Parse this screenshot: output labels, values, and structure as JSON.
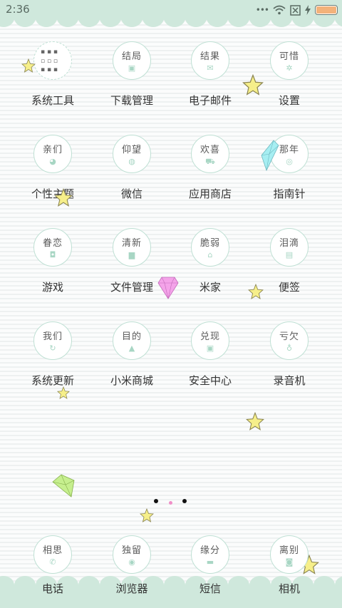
{
  "status": {
    "time": "2:36"
  },
  "apps": [
    {
      "cap": "",
      "glyph": "",
      "label": "系统工具"
    },
    {
      "cap": "结局",
      "glyph": "▣",
      "label": "下载管理"
    },
    {
      "cap": "结果",
      "glyph": "✉",
      "label": "电子邮件"
    },
    {
      "cap": "可惜",
      "glyph": "✲",
      "label": "设置"
    },
    {
      "cap": "亲们",
      "glyph": "◕",
      "label": "个性主题"
    },
    {
      "cap": "仰望",
      "glyph": "◍",
      "label": "微信"
    },
    {
      "cap": "欢喜",
      "glyph": "⛟",
      "label": "应用商店"
    },
    {
      "cap": "那年",
      "glyph": "◎",
      "label": "指南针"
    },
    {
      "cap": "眷恋",
      "glyph": "◘",
      "label": "游戏"
    },
    {
      "cap": "清新",
      "glyph": "▆",
      "label": "文件管理"
    },
    {
      "cap": "脆弱",
      "glyph": "⌂",
      "label": "米家"
    },
    {
      "cap": "泪滴",
      "glyph": "▤",
      "label": "便签"
    },
    {
      "cap": "我们",
      "glyph": "↻",
      "label": "系统更新"
    },
    {
      "cap": "目的",
      "glyph": "▲",
      "label": "小米商城"
    },
    {
      "cap": "兑现",
      "glyph": "▣",
      "label": "安全中心"
    },
    {
      "cap": "亏欠",
      "glyph": "♁",
      "label": "录音机"
    }
  ],
  "dock": [
    {
      "cap": "相思",
      "glyph": "✆",
      "label": "电话"
    },
    {
      "cap": "独留",
      "glyph": "◉",
      "label": "浏览器"
    },
    {
      "cap": "缘分",
      "glyph": "▬",
      "label": "短信"
    },
    {
      "cap": "离别",
      "glyph": "◙",
      "label": "相机"
    }
  ],
  "colors": {
    "accent": "#cfe8dc",
    "ring": "#bfe0d4",
    "battery": "#f3b27a",
    "star": "#f6ef8a",
    "diamond_pink": "#f4a3e9",
    "diamond_blue": "#a6eef2",
    "diamond_green": "#c6ef8e"
  }
}
